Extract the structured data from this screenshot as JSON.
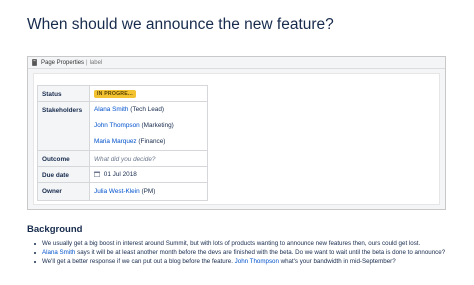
{
  "page": {
    "title": "When should we announce the new feature?"
  },
  "macro": {
    "title": "Page Properties",
    "separator": "|",
    "subtitle": "label",
    "icon": "page-properties-icon"
  },
  "properties": {
    "status": {
      "label": "Status",
      "badge": "IN PROGRE...",
      "badge_color": "#f2c232"
    },
    "stakeholders": {
      "label": "Stakeholders",
      "people": [
        {
          "name": "Alana Smith",
          "role": "(Tech Lead)"
        },
        {
          "name": "John Thompson",
          "role": "(Marketing)"
        },
        {
          "name": "Maria Marquez",
          "role": "(Finance)"
        }
      ]
    },
    "outcome": {
      "label": "Outcome",
      "placeholder": "What did you decide?"
    },
    "due_date": {
      "label": "Due date",
      "value": "01 Jul 2018",
      "icon": "calendar-icon"
    },
    "owner": {
      "label": "Owner",
      "name": "Julia West-Klein",
      "role": "(PM)"
    }
  },
  "background": {
    "title": "Background",
    "bullets": [
      {
        "parts": [
          {
            "text": "We usually get a big boost in interest around Summit, but with lots of products wanting to announce new features then, ours could get lost."
          }
        ]
      },
      {
        "parts": [
          {
            "text": "Alana Smith",
            "mention": true
          },
          {
            "text": " says it will be at least another month before the devs are finished with the beta. Do we want to wait until the beta is done to announce?"
          }
        ]
      },
      {
        "parts": [
          {
            "text": "We'll get a better response if we can put out a blog before the feature. "
          },
          {
            "text": "John Thompson",
            "mention": true
          },
          {
            "text": " what's your bandwidth in mid-September?"
          }
        ]
      }
    ]
  },
  "colors": {
    "link": "#0052cc",
    "text": "#172b4d",
    "status_badge": "#f2c232"
  }
}
